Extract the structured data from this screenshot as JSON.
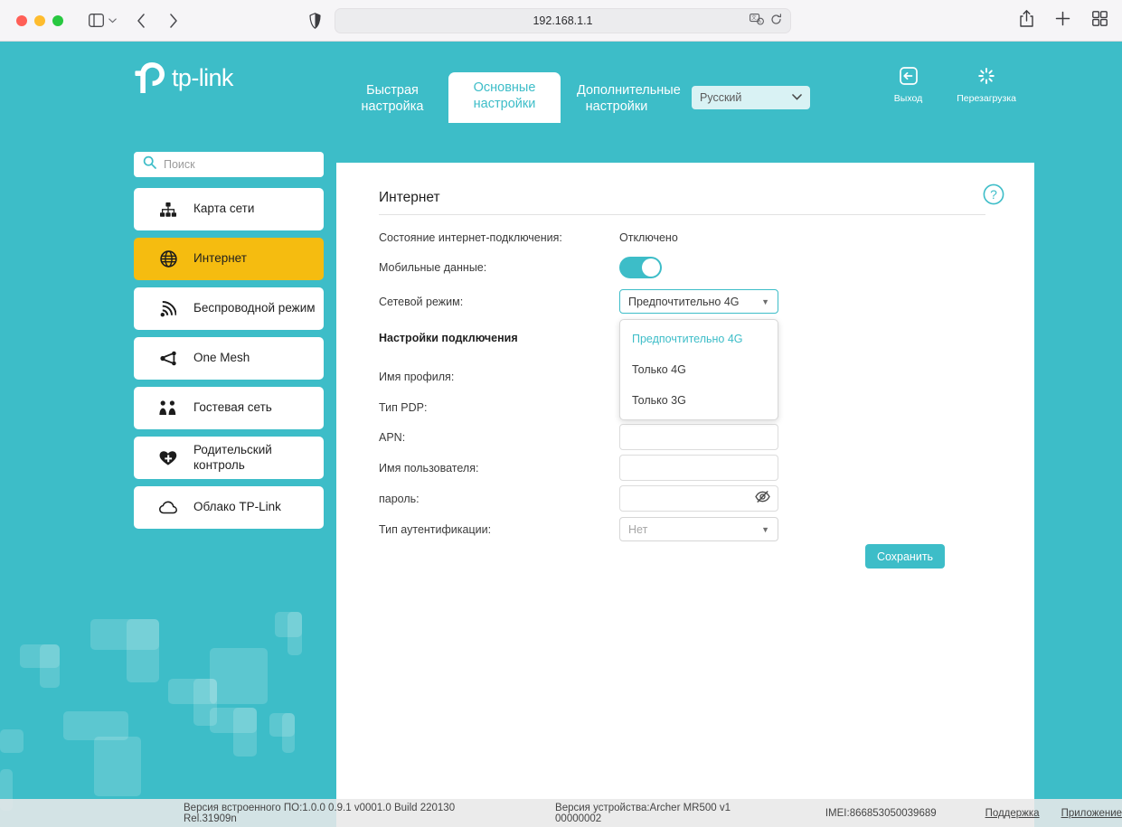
{
  "browser": {
    "url": "192.168.1.1",
    "icons": {
      "sidebar": "sidebar-toggle-icon",
      "back": "back-arrow-icon",
      "forward": "forward-arrow-icon",
      "shield": "privacy-shield-icon",
      "translate": "translate-icon",
      "reload": "reload-icon",
      "share": "share-icon",
      "newtab": "plus-icon",
      "tabs": "tab-overview-icon"
    }
  },
  "header": {
    "brand": "tp-link",
    "tabs": [
      {
        "line1": "Быстрая",
        "line2": "настройка",
        "active": false
      },
      {
        "line1": "Основные",
        "line2": "настройки",
        "active": true
      },
      {
        "line1": "Дополнительные",
        "line2": "настройки",
        "active": false
      }
    ],
    "language": "Русский",
    "actions": [
      {
        "label": "Выход",
        "icon": "logout-icon"
      },
      {
        "label": "Перезагрузка",
        "icon": "reboot-icon"
      }
    ]
  },
  "sidebar": {
    "search_placeholder": "Поиск",
    "search_value": "",
    "items": [
      {
        "label": "Карта сети",
        "icon": "network-map-icon",
        "active": false
      },
      {
        "label": "Интернет",
        "icon": "globe-icon",
        "active": true
      },
      {
        "label": "Беспроводной режим",
        "icon": "wifi-icon",
        "active": false
      },
      {
        "label": "One Mesh",
        "icon": "mesh-icon",
        "active": false
      },
      {
        "label": "Гостевая сеть",
        "icon": "guest-network-icon",
        "active": false
      },
      {
        "label": "Родительский контроль",
        "icon": "parental-control-icon",
        "active": false
      },
      {
        "label": "Облако TP-Link",
        "icon": "cloud-icon",
        "active": false
      }
    ]
  },
  "main": {
    "title": "Интернет",
    "help_icon": "help-icon",
    "status_label": "Состояние интернет-подключения:",
    "status_value": "Отключено",
    "mobile_data_label": "Мобильные данные:",
    "mobile_data_on": true,
    "network_mode_label": "Сетевой режим:",
    "network_mode_value": "Предпочтительно 4G",
    "network_mode_options": [
      "Предпочтительно 4G",
      "Только 4G",
      "Только 3G"
    ],
    "connection_settings_label": "Настройки подключения",
    "profile_name_label": "Имя профиля:",
    "pdp_type_label": "Тип PDP:",
    "apn_label": "APN:",
    "apn_value": "",
    "username_label": "Имя пользователя:",
    "username_value": "",
    "password_label": "пароль:",
    "password_value": "",
    "password_eye_icon": "eye-slash-icon",
    "auth_type_label": "Тип аутентификации:",
    "auth_type_value": "Нет",
    "save_label": "Сохранить"
  },
  "footer": {
    "firmware": "Версия встроенного ПО:1.0.0 0.9.1 v0001.0 Build 220130 Rel.31909n",
    "hardware": "Версия устройства:Archer MR500 v1 00000002",
    "imei": "IMEI:866853050039689",
    "support_link": "Поддержка",
    "app_link": "Приложение"
  },
  "colors": {
    "teal": "#3dbdc8",
    "amber": "#f5bc10",
    "panel": "#ffffff"
  }
}
